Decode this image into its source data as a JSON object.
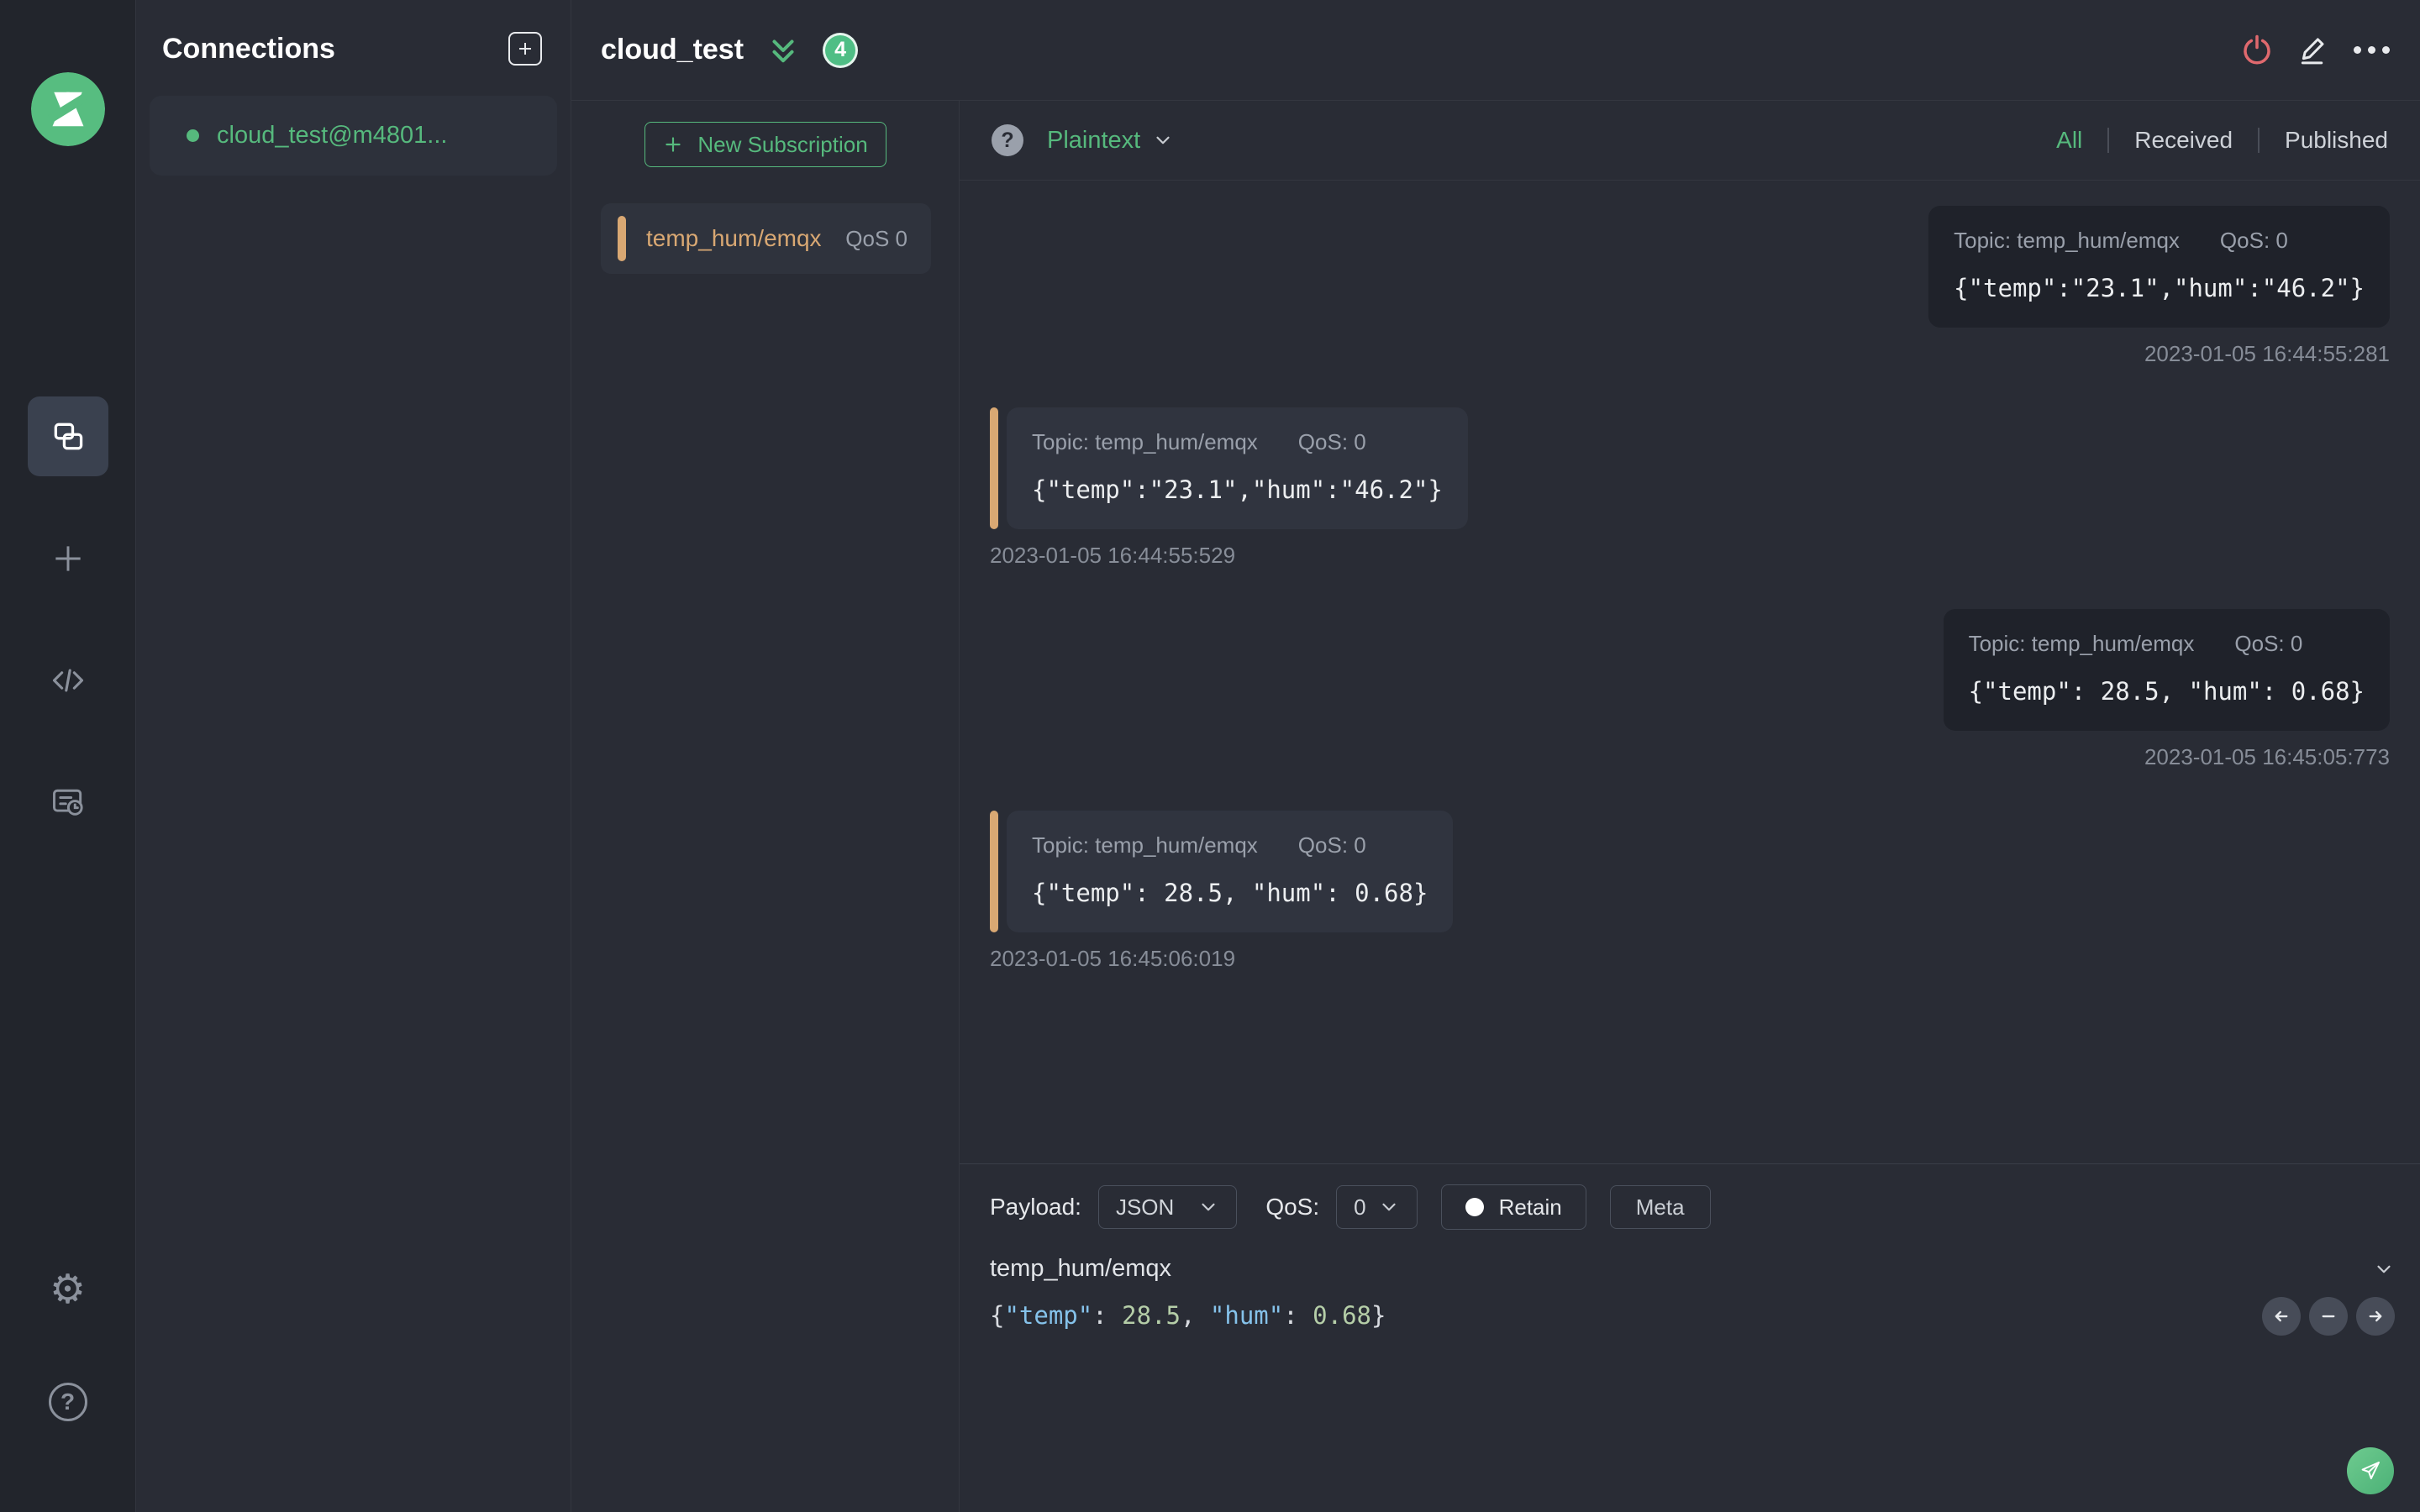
{
  "colors": {
    "accent_green": "#56b97d",
    "badge_green": "#4fbe85",
    "danger_red": "#e0696e",
    "topic_orange": "#d9a873",
    "syntax_key_blue": "#85c2ea",
    "syntax_number_green": "#b5cea8"
  },
  "sidebar": {
    "icons": [
      "mqttx-logo",
      "connections",
      "new-connection",
      "script",
      "log",
      "settings",
      "help"
    ]
  },
  "connections_panel": {
    "title": "Connections",
    "items": [
      {
        "name": "cloud_test@m4801...",
        "status": "connected"
      }
    ]
  },
  "header": {
    "title": "cloud_test",
    "badge_count": "4"
  },
  "subscriptions": {
    "new_button_label": "New Subscription",
    "items": [
      {
        "topic": "temp_hum/emqx",
        "qos_label": "QoS 0"
      }
    ]
  },
  "messages": {
    "payload_type": "Plaintext",
    "help_glyph": "?",
    "filters": {
      "all": "All",
      "received": "Received",
      "published": "Published"
    },
    "active_filter": "All",
    "items": [
      {
        "direction": "published",
        "topic_label": "Topic: temp_hum/emqx",
        "qos_label": "QoS: 0",
        "payload": "{\"temp\":\"23.1\",\"hum\":\"46.2\"}",
        "timestamp": "2023-01-05 16:44:55:281"
      },
      {
        "direction": "received",
        "topic_label": "Topic: temp_hum/emqx",
        "qos_label": "QoS: 0",
        "payload": "{\"temp\":\"23.1\",\"hum\":\"46.2\"}",
        "timestamp": "2023-01-05 16:44:55:529"
      },
      {
        "direction": "published",
        "topic_label": "Topic: temp_hum/emqx",
        "qos_label": "QoS: 0",
        "payload": "{\"temp\": 28.5, \"hum\": 0.68}",
        "timestamp": "2023-01-05 16:45:05:773"
      },
      {
        "direction": "received",
        "topic_label": "Topic: temp_hum/emqx",
        "qos_label": "QoS: 0",
        "payload": "{\"temp\": 28.5, \"hum\": 0.68}",
        "timestamp": "2023-01-05 16:45:06:019"
      }
    ]
  },
  "publish": {
    "payload_label": "Payload:",
    "payload_format": "JSON",
    "qos_label": "QoS:",
    "qos_value": "0",
    "retain_label": "Retain",
    "meta_label": "Meta",
    "topic": "temp_hum/emqx",
    "editor_tokens": [
      {
        "text": "{"
      },
      {
        "text": "\"temp\""
      },
      {
        "text": ": "
      },
      {
        "text": "28.5"
      },
      {
        "text": ", "
      },
      {
        "text": "\"hum\""
      },
      {
        "text": ": "
      },
      {
        "text": "0.68"
      },
      {
        "text": "}"
      }
    ]
  }
}
